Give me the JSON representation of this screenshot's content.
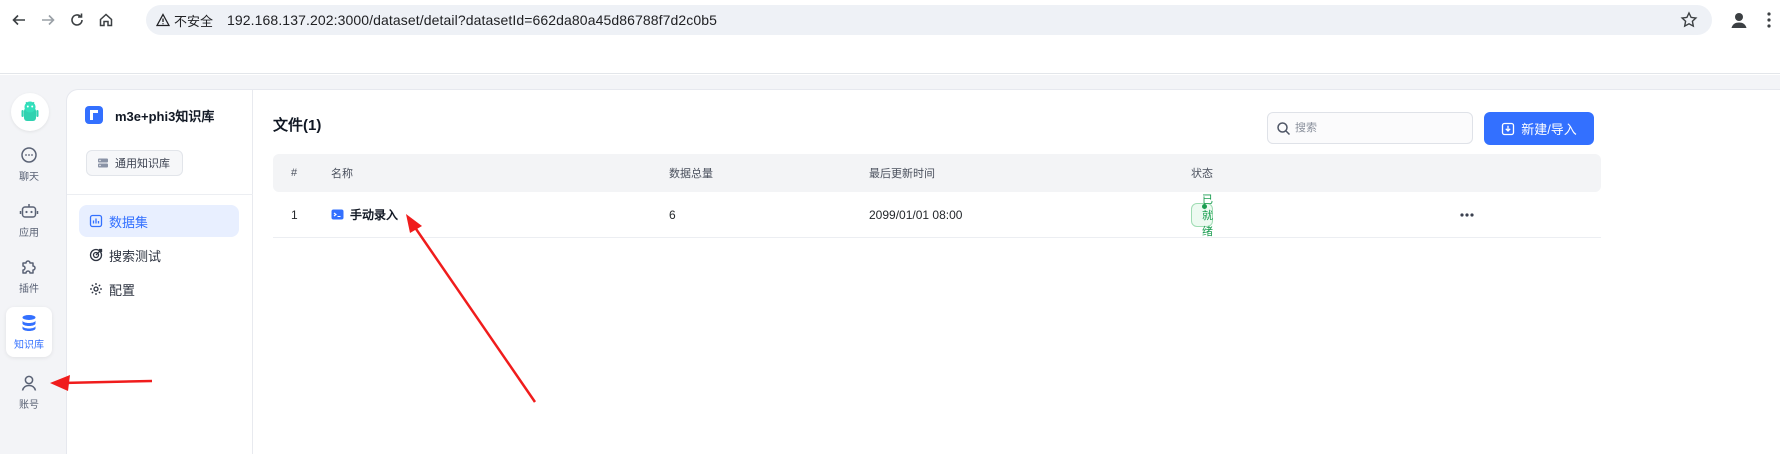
{
  "browser": {
    "security_label": "不安全",
    "url": "192.168.137.202:3000/dataset/detail?datasetId=662da80a45d86788f7d2c0b5"
  },
  "rail": {
    "items": [
      {
        "label": "聊天",
        "icon": "chat-icon"
      },
      {
        "label": "应用",
        "icon": "robot-icon"
      },
      {
        "label": "插件",
        "icon": "puzzle-icon"
      },
      {
        "label": "知识库",
        "icon": "database-icon"
      },
      {
        "label": "账号",
        "icon": "user-icon"
      }
    ]
  },
  "dataset": {
    "name": "m3e+phi3知识库",
    "type_label": "通用知识库"
  },
  "side_menu": [
    {
      "label": "数据集",
      "active": true
    },
    {
      "label": "搜索测试",
      "active": false
    },
    {
      "label": "配置",
      "active": false
    }
  ],
  "files": {
    "title": "文件(1)",
    "search_placeholder": "搜索",
    "new_button": "新建/导入",
    "columns": [
      "#",
      "名称",
      "数据总量",
      "最后更新时间",
      "状态"
    ],
    "rows": [
      {
        "index": "1",
        "name": "手动录入",
        "count": "6",
        "updated": "2099/01/01 08:00",
        "status": "已就绪"
      }
    ]
  },
  "colors": {
    "accent": "#3370ff",
    "status_green": "#1a9d50",
    "annotation_red": "#f01c1c"
  }
}
